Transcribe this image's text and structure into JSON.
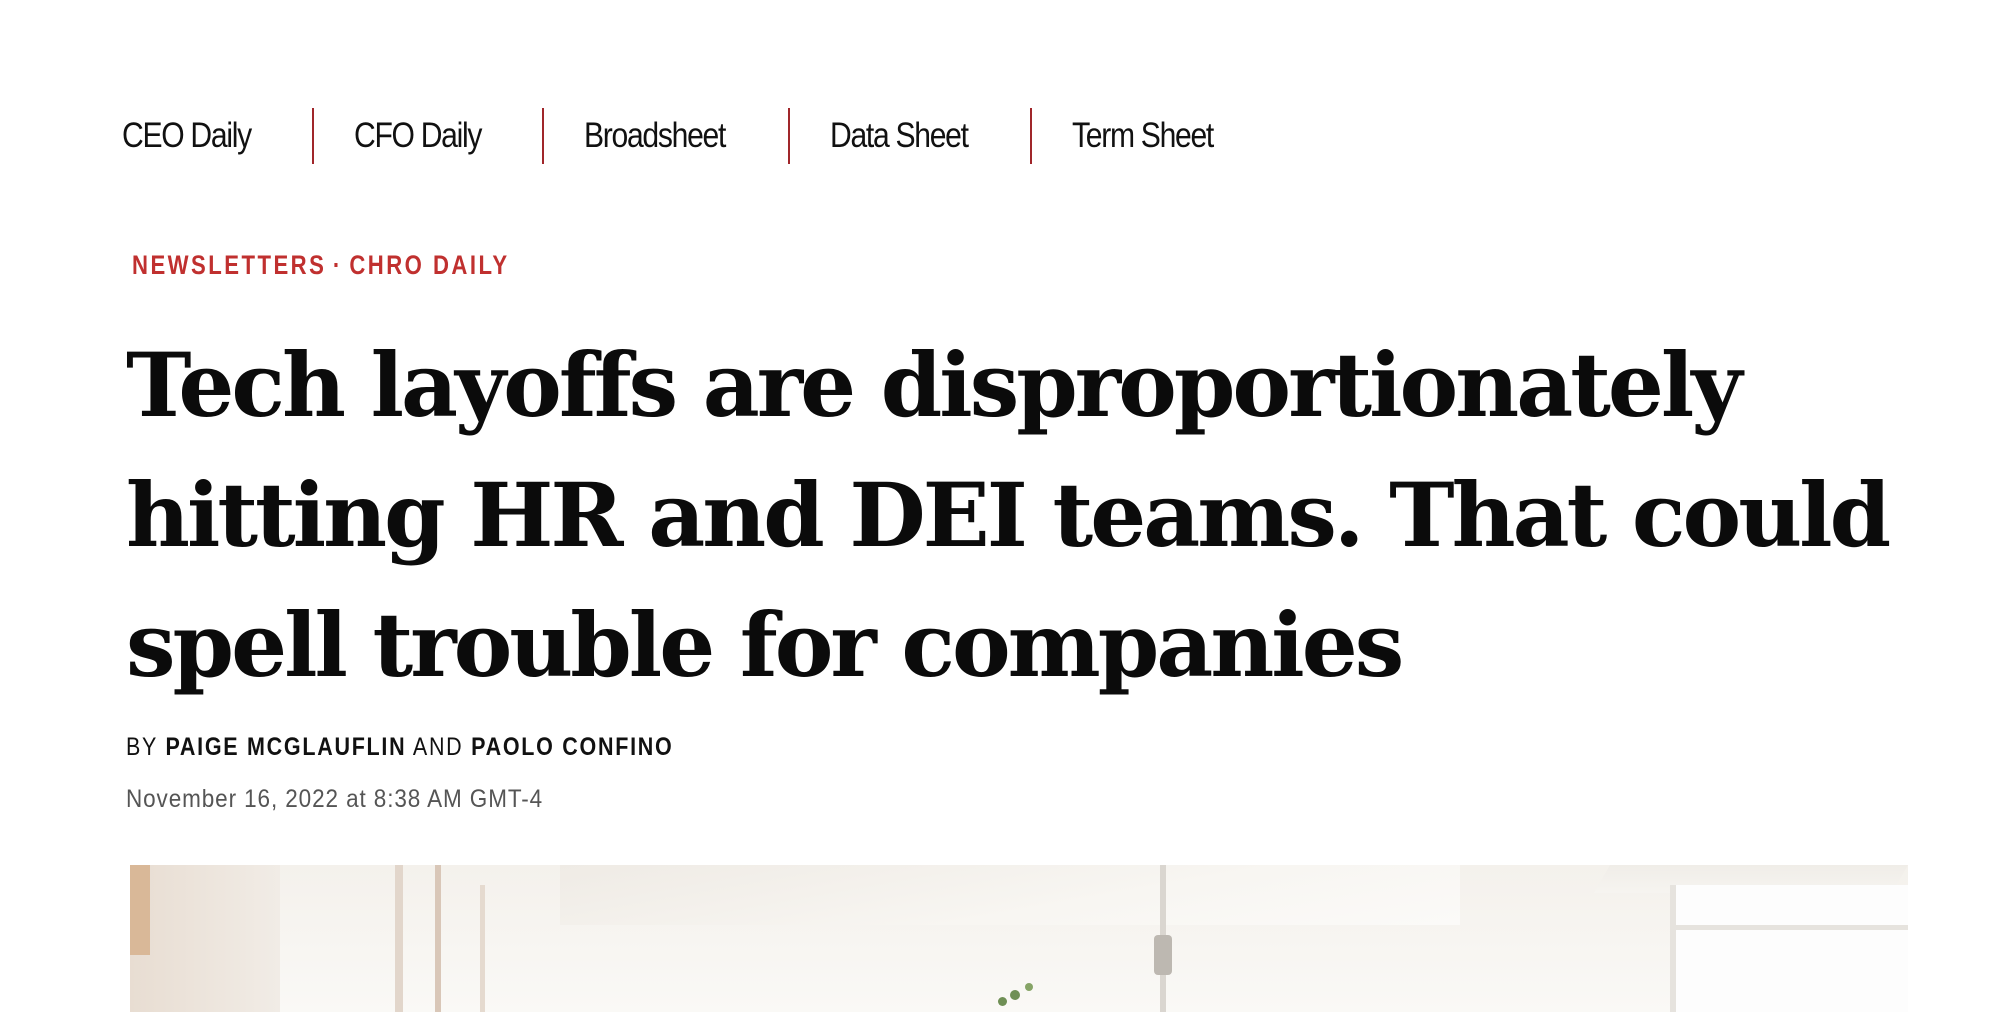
{
  "nav": {
    "items": [
      {
        "label": "CEO Daily"
      },
      {
        "label": "CFO Daily"
      },
      {
        "label": "Broadsheet"
      },
      {
        "label": "Data Sheet"
      },
      {
        "label": "Term Sheet"
      }
    ],
    "separator_color": "#a0262a"
  },
  "article": {
    "eyebrow": {
      "section": "NEWSLETTERS",
      "separator": "·",
      "subsection": "CHRO DAILY",
      "color": "#c0302f"
    },
    "headline": "Tech layoffs are disproportionately hitting HR and DEI teams. That could spell trouble for companies",
    "byline": {
      "prefix": "BY",
      "author_1": "PAIGE MCGLAUFLIN",
      "conjunction": "AND",
      "author_2": "PAOLO CONFINO"
    },
    "timestamp": "November 16, 2022 at 8:38 AM GMT-4"
  },
  "hero": {
    "icon": "photo-image"
  }
}
